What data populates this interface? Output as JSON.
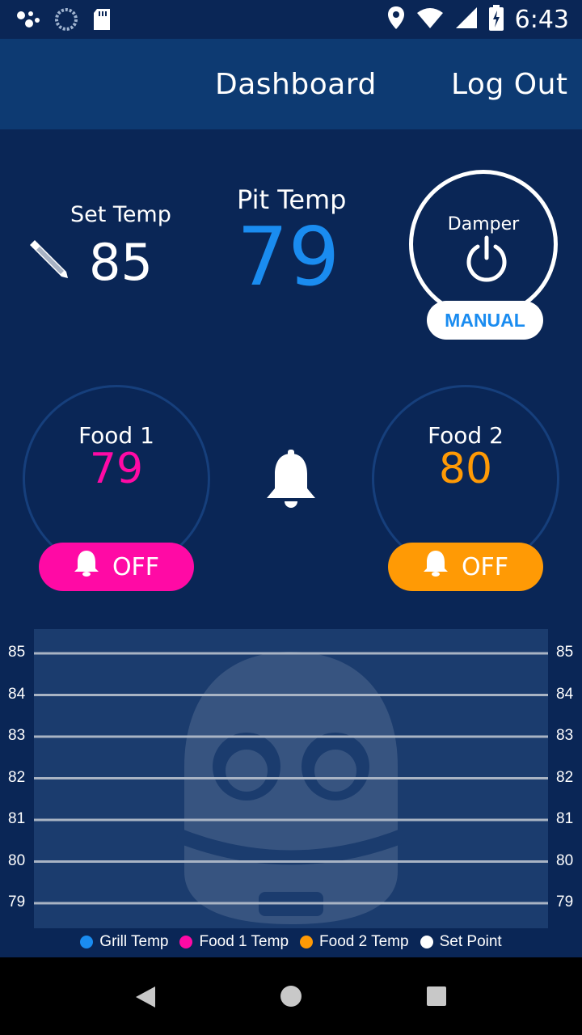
{
  "status_bar": {
    "time": "6:43",
    "icons": [
      "assistant-icon",
      "sync-icon",
      "sd-card-icon",
      "location-icon",
      "wifi-icon",
      "signal-icon",
      "battery-charging-icon"
    ]
  },
  "header": {
    "dashboard_label": "Dashboard",
    "logout_label": "Log Out"
  },
  "set_temp": {
    "label": "Set Temp",
    "value": "85"
  },
  "pit_temp": {
    "label": "Pit Temp",
    "value": "79"
  },
  "damper": {
    "label": "Damper",
    "mode": "MANUAL"
  },
  "food1": {
    "label": "Food 1",
    "value": "79",
    "alarm": "OFF",
    "color": "#ff0aa5"
  },
  "food2": {
    "label": "Food 2",
    "value": "80",
    "alarm": "OFF",
    "color": "#ff9a05"
  },
  "colors": {
    "background": "#0a2656",
    "appbar": "#0d3a72",
    "accent": "#1a8cf0"
  },
  "chart_data": {
    "type": "line",
    "yticks": [
      "85",
      "84",
      "83",
      "82",
      "81",
      "80",
      "79"
    ],
    "ylim": [
      79,
      85
    ],
    "series": [
      {
        "name": "Grill Temp",
        "color": "#1a8cf0",
        "values": []
      },
      {
        "name": "Food 1 Temp",
        "color": "#ff0aa5",
        "values": []
      },
      {
        "name": "Food 2 Temp",
        "color": "#ff9a05",
        "values": []
      },
      {
        "name": "Set Point",
        "color": "#ffffff",
        "values": []
      }
    ],
    "grid": true,
    "legend": "bottom"
  }
}
